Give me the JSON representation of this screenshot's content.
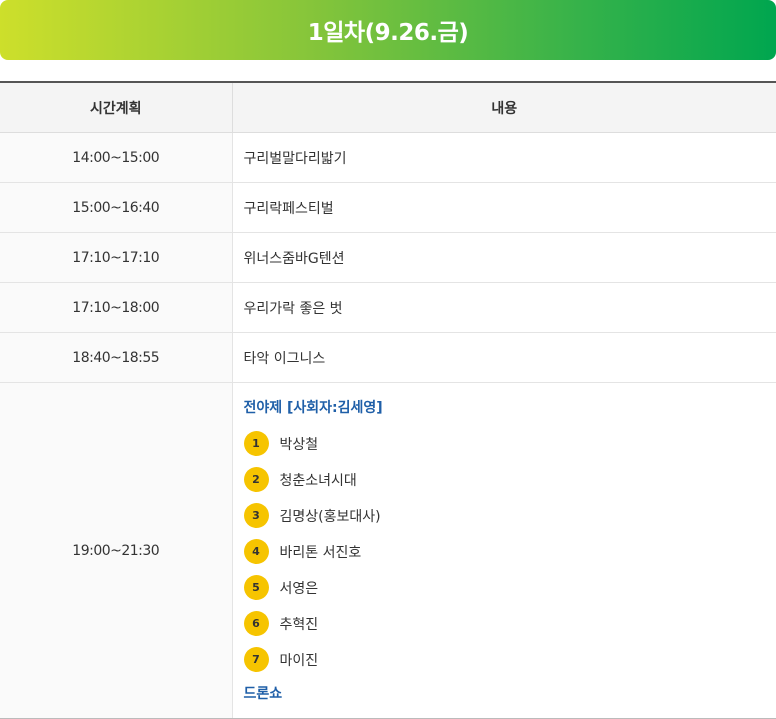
{
  "header": {
    "title": "1일차(9.26.금)"
  },
  "table": {
    "columns": {
      "time": "시간계획",
      "content": "내용"
    },
    "rows": [
      {
        "time": "14:00~15:00",
        "content": "구리벌말다리밟기"
      },
      {
        "time": "15:00~16:40",
        "content": "구리락페스티벌"
      },
      {
        "time": "17:10~17:10",
        "content": "위너스줌바G텐션"
      },
      {
        "time": "17:10~18:00",
        "content": "우리가락 좋은 벗"
      },
      {
        "time": "18:40~18:55",
        "content": "타악 이그니스"
      }
    ],
    "last_row": {
      "time": "19:00~21:30",
      "ceremony_title": "전야제 [사회자:김세영]",
      "performers": [
        {
          "num": "1",
          "name": "박상철"
        },
        {
          "num": "2",
          "name": "청춘소녀시대"
        },
        {
          "num": "3",
          "name": "김명상(홍보대사)"
        },
        {
          "num": "4",
          "name": "바리톤 서진호"
        },
        {
          "num": "5",
          "name": "서영은"
        },
        {
          "num": "6",
          "name": "추혁진"
        },
        {
          "num": "7",
          "name": "마이진"
        }
      ],
      "finale": "드론쇼"
    }
  },
  "colors": {
    "header_gradient_start": "#cddf2b",
    "header_gradient_end": "#00a64f",
    "accent_blue": "#1f5fa8",
    "badge_yellow": "#f6c400"
  }
}
